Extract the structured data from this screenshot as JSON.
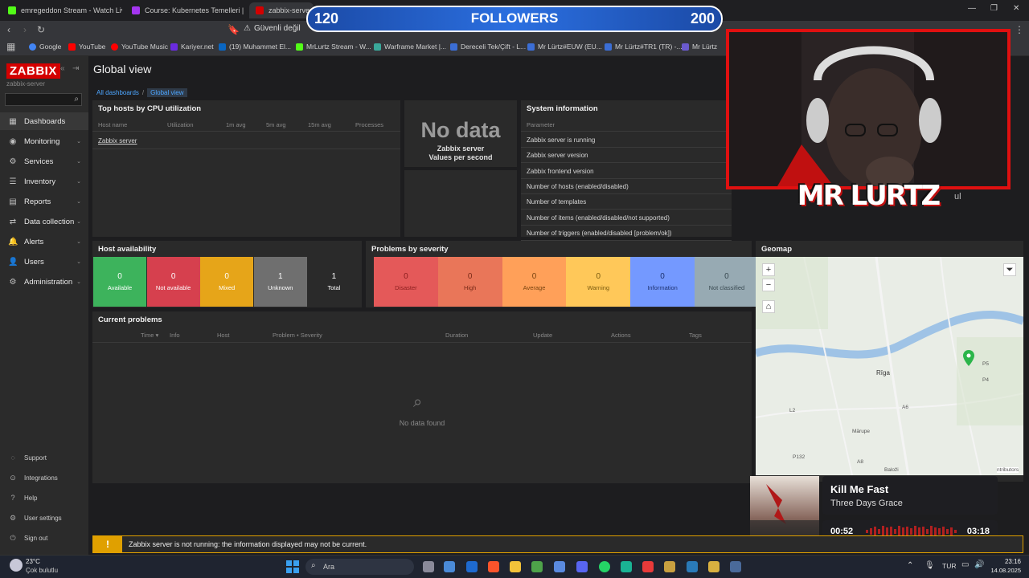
{
  "browser": {
    "tabs": [
      {
        "title": "emregeddon Stream - Watch Live on",
        "color": "#53fc18"
      },
      {
        "title": "Course: Kubernetes Temelleri | Udem",
        "color": "#a435f0"
      },
      {
        "title": "zabbix-server: D",
        "color": "#d40000"
      }
    ],
    "address_secure": "Güvenli değil",
    "bookmarks": [
      "Google",
      "YouTube",
      "YouTube Music",
      "Kariyer.net",
      "(19) Muhammet El...",
      "MrLurtz Stream - W...",
      "Warframe Market |...",
      "Dereceli Tek/Çift - L...",
      "Mr Lürtz#EUW (EU...",
      "Mr Lürtz#TR1 (TR) -...",
      "Mr Lürtz"
    ]
  },
  "sidebar": {
    "logo": "ZABBIX",
    "server": "zabbix-server",
    "menu": [
      {
        "label": "Dashboards",
        "icon": "dashboard-icon",
        "glyph": "▦"
      },
      {
        "label": "Monitoring",
        "icon": "monitoring-icon",
        "glyph": "◉"
      },
      {
        "label": "Services",
        "icon": "services-icon",
        "glyph": "⚙"
      },
      {
        "label": "Inventory",
        "icon": "inventory-icon",
        "glyph": "☰"
      },
      {
        "label": "Reports",
        "icon": "reports-icon",
        "glyph": "▤"
      },
      {
        "label": "Data collection",
        "icon": "data-collection-icon",
        "glyph": "⇄"
      },
      {
        "label": "Alerts",
        "icon": "bell-icon",
        "glyph": "🔔"
      },
      {
        "label": "Users",
        "icon": "users-icon",
        "glyph": "👤"
      },
      {
        "label": "Administration",
        "icon": "gear-icon",
        "glyph": "⚙"
      }
    ],
    "bottom": [
      {
        "label": "Support",
        "icon": "support-icon",
        "glyph": "◌"
      },
      {
        "label": "Integrations",
        "icon": "integrations-icon",
        "glyph": "⊙"
      },
      {
        "label": "Help",
        "icon": "help-icon",
        "glyph": "?"
      },
      {
        "label": "User settings",
        "icon": "user-settings-icon",
        "glyph": "⚙"
      },
      {
        "label": "Sign out",
        "icon": "sign-out-icon",
        "glyph": "⏻"
      }
    ]
  },
  "main": {
    "title": "Global view",
    "breadcrumb": {
      "all": "All dashboards",
      "sep": "/",
      "current": "Global view"
    },
    "top_hosts": {
      "title": "Top hosts by CPU utilization",
      "columns": [
        "Host name",
        "Utilization",
        "1m avg",
        "5m avg",
        "15m avg",
        "Processes"
      ],
      "rows": [
        "Zabbix server"
      ]
    },
    "nodata": {
      "big": "No data",
      "line1": "Zabbix server",
      "line2": "Values per second"
    },
    "sysinfo": {
      "title": "System information",
      "column": "Parameter",
      "rows": [
        "Zabbix server is running",
        "Zabbix server version",
        "Zabbix frontend version",
        "Number of hosts (enabled/disabled)",
        "Number of templates",
        "Number of items (enabled/disabled/not supported)",
        "Number of triggers (enabled/disabled [problem/ok])"
      ]
    },
    "host_avail": {
      "title": "Host availability",
      "cells": [
        {
          "n": "0",
          "label": "Available",
          "color": "#3db35c"
        },
        {
          "n": "0",
          "label": "Not available",
          "color": "#d6404e"
        },
        {
          "n": "0",
          "label": "Mixed",
          "color": "#e6a519"
        },
        {
          "n": "1",
          "label": "Unknown",
          "color": "#6f6f6f"
        },
        {
          "n": "1",
          "label": "Total",
          "color": "#2a2a2a"
        }
      ]
    },
    "problems_sev": {
      "title": "Problems by severity",
      "cells": [
        {
          "n": "0",
          "label": "Disaster",
          "color": "#e45959",
          "text": "#8a1e1e"
        },
        {
          "n": "0",
          "label": "High",
          "color": "#e97659",
          "text": "#7a2b18"
        },
        {
          "n": "0",
          "label": "Average",
          "color": "#ffa059",
          "text": "#7a4410"
        },
        {
          "n": "0",
          "label": "Warning",
          "color": "#ffc859",
          "text": "#7a5a10"
        },
        {
          "n": "0",
          "label": "Information",
          "color": "#7499ff",
          "text": "#1e3270"
        },
        {
          "n": "0",
          "label": "Not classified",
          "color": "#97aab3",
          "text": "#3a4a52"
        }
      ]
    },
    "current_problems": {
      "title": "Current problems",
      "columns": [
        "Time ▾",
        "Info",
        "Host",
        "Problem • Severity",
        "Duration",
        "Update",
        "Actions",
        "Tags"
      ],
      "empty": "No data found"
    },
    "geomap": {
      "title": "Geomap",
      "labels": [
        "Rīga",
        "Mārupe",
        "Baloži",
        "P132",
        "L2",
        "A8",
        "A6",
        "P4",
        "P5",
        "ntributors"
      ]
    },
    "warning": "Zabbix server is not running: the information displayed may not be current."
  },
  "overlay": {
    "followers_current": "120",
    "followers_label": "FOLLOWERS",
    "followers_goal": "200",
    "brand": "MR LURTZ",
    "cam_text": "ul",
    "song": "Kill Me Fast",
    "artist": "Three Days Grace",
    "elapsed": "00:52",
    "total": "03:18"
  },
  "taskbar": {
    "weather_temp": "23°C",
    "weather_desc": "Çok bulutlu",
    "search": "Ara",
    "lang": "TUR",
    "time": "23:16",
    "date": "14.08.2025"
  }
}
